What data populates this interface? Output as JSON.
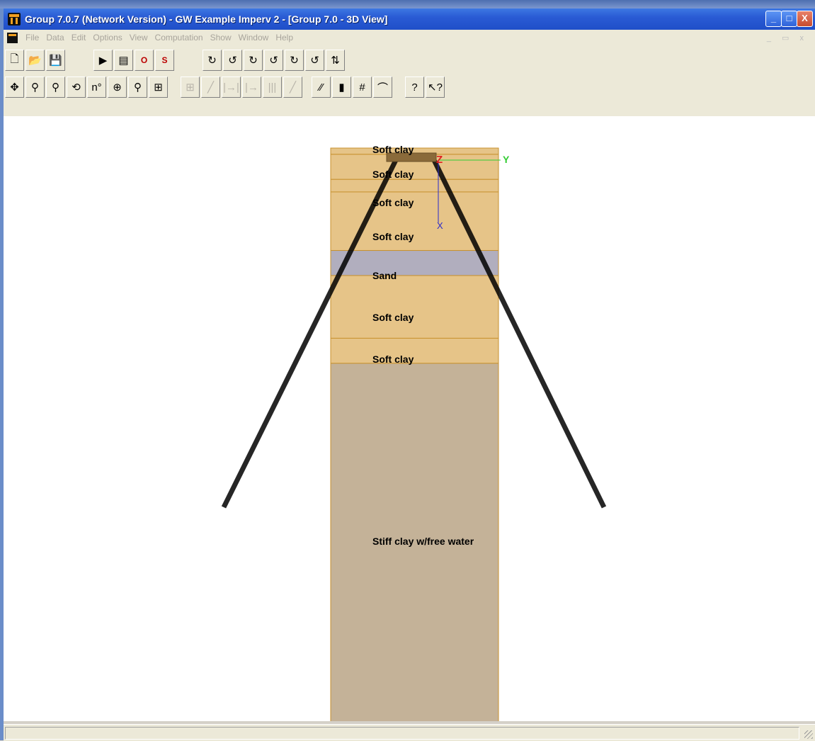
{
  "window": {
    "title": "Group 7.0.7 (Network Version) - GW Example Imperv 2 - [Group 7.0 - 3D View]",
    "min_label": "_",
    "max_label": "□",
    "close_label": "X"
  },
  "menu": [
    "File",
    "Data",
    "Edit",
    "Options",
    "View",
    "Computation",
    "Show",
    "Window",
    "Help"
  ],
  "mdi_controls": "_ ▭ x",
  "toolbar1": [
    {
      "name": "new-file-icon",
      "glyph": "🗋",
      "disabled": false
    },
    {
      "name": "open-folder-icon",
      "glyph": "📂",
      "disabled": false
    },
    {
      "name": "save-icon",
      "glyph": "💾",
      "disabled": false
    },
    {
      "name": "run-icon",
      "glyph": "▶",
      "disabled": false
    },
    {
      "name": "input-file-icon",
      "glyph": "▤",
      "disabled": false
    },
    {
      "name": "output-file-icon",
      "glyph": "O",
      "disabled": false
    },
    {
      "name": "summary-file-icon",
      "glyph": "S",
      "disabled": false
    },
    {
      "name": "rotate-xy-icon",
      "glyph": "↻",
      "disabled": false
    },
    {
      "name": "rotate-yx-icon",
      "glyph": "↺",
      "disabled": false
    },
    {
      "name": "rotate-zx-icon",
      "glyph": "↻",
      "disabled": false
    },
    {
      "name": "rotate-xz-icon",
      "glyph": "↺",
      "disabled": false
    },
    {
      "name": "rotate-zy-icon",
      "glyph": "↻",
      "disabled": false
    },
    {
      "name": "rotate-yz-icon",
      "glyph": "↺",
      "disabled": false
    },
    {
      "name": "rotate-3d-icon",
      "glyph": "⇅",
      "disabled": false
    }
  ],
  "toolbar2": [
    {
      "name": "pan-icon",
      "glyph": "✥",
      "disabled": false
    },
    {
      "name": "zoom-icon",
      "glyph": "⚲",
      "disabled": false
    },
    {
      "name": "zoom-window-icon",
      "glyph": "⚲",
      "disabled": false
    },
    {
      "name": "rotate-view-icon",
      "glyph": "⟲",
      "disabled": false
    },
    {
      "name": "node-number-icon",
      "glyph": "n°",
      "disabled": false
    },
    {
      "name": "zoom-in-icon",
      "glyph": "⊕",
      "disabled": false
    },
    {
      "name": "zoom-out-icon",
      "glyph": "⚲",
      "disabled": false
    },
    {
      "name": "grid-icon",
      "glyph": "⊞",
      "disabled": false
    },
    {
      "name": "pile-cap-icon",
      "glyph": "⊞",
      "disabled": true
    },
    {
      "name": "pile-line-icon",
      "glyph": "╱",
      "disabled": true
    },
    {
      "name": "pile-spacing-icon",
      "glyph": "|→|",
      "disabled": true
    },
    {
      "name": "pile-offset-icon",
      "glyph": "|→",
      "disabled": true
    },
    {
      "name": "pile-group-icon",
      "glyph": "|||",
      "disabled": true
    },
    {
      "name": "batter-icon",
      "glyph": "╱",
      "disabled": true
    },
    {
      "name": "deflection-icon",
      "glyph": "⁄⁄",
      "disabled": false
    },
    {
      "name": "color-legend-icon",
      "glyph": "▮",
      "disabled": false
    },
    {
      "name": "pile-head-icon",
      "glyph": "#",
      "disabled": false
    },
    {
      "name": "load-curve-icon",
      "glyph": "⌒",
      "disabled": false
    },
    {
      "name": "help-icon",
      "glyph": "?",
      "disabled": false
    },
    {
      "name": "context-help-icon",
      "glyph": "↖?",
      "disabled": false
    }
  ],
  "view3d": {
    "axes": {
      "y_label": "Y",
      "z_label": "Z",
      "x_label": "X"
    },
    "soil_layers": [
      {
        "label": "Soft clay",
        "depth_from": 0,
        "depth_to": 0.3,
        "color": "#e6c488"
      },
      {
        "label": "Soft clay",
        "depth_from": 0.3,
        "depth_to": 1.5,
        "color": "#e6c488"
      },
      {
        "label": "Soft clay",
        "depth_from": 1.5,
        "depth_to": 2.1,
        "color": "#e6c488"
      },
      {
        "label": "Soft clay",
        "depth_from": 2.1,
        "depth_to": 4.9,
        "color": "#e6c488"
      },
      {
        "label": "Sand",
        "depth_from": 4.9,
        "depth_to": 6.1,
        "color": "#b1aebe"
      },
      {
        "label": "Soft clay",
        "depth_from": 6.1,
        "depth_to": 9.1,
        "color": "#e6c488"
      },
      {
        "label": "Soft clay",
        "depth_from": 9.1,
        "depth_to": 10.3,
        "color": "#e6c488"
      },
      {
        "label": "Stiff clay w/free water",
        "depth_from": 10.3,
        "depth_to": 27.5,
        "color": "#c4b298"
      }
    ]
  },
  "status": {
    "text": ""
  }
}
